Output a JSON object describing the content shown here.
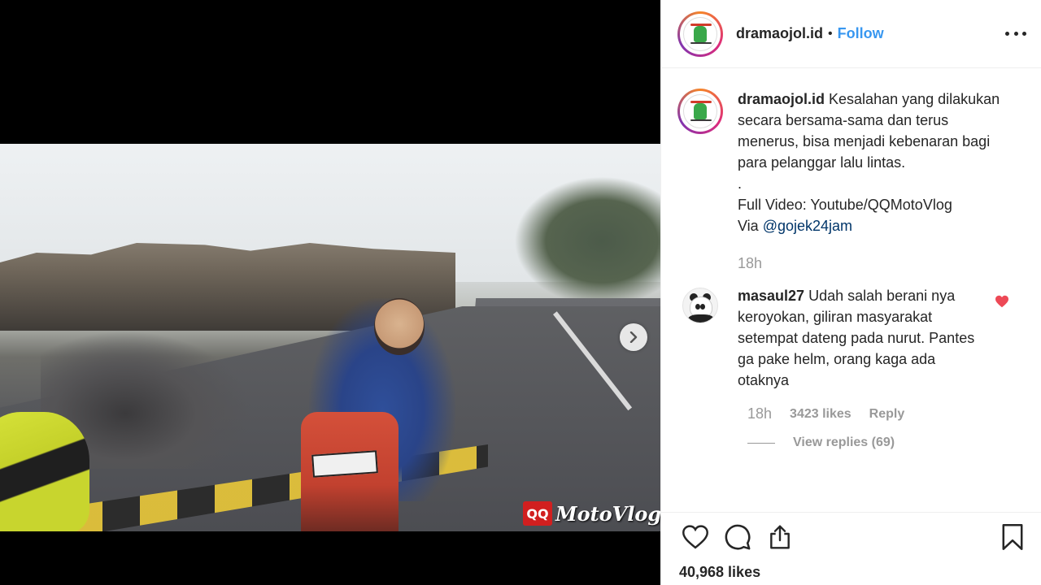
{
  "header": {
    "username": "dramaojol.id",
    "separator": "•",
    "follow_label": "Follow",
    "more_icon": "more-horizontal-icon"
  },
  "caption": {
    "username": "dramaojol.id",
    "text": "Kesalahan yang dilakukan secara bersama-sama dan terus menerus, bisa menjadi kebenaran bagi para pelanggar lalu lintas.",
    "dot": ".",
    "full_video": "Full Video: Youtube/QQMotoVlog",
    "via_prefix": "Via ",
    "mention": "@gojek24jam",
    "time": "18h"
  },
  "comment": {
    "username": "masaul27",
    "text": "Udah salah berani nya keroyokan, giliran masyarakat setempat dateng pada nurut. Pantes ga pake helm, orang kaga ada otaknya",
    "time": "18h",
    "likes": "3423 likes",
    "reply_label": "Reply",
    "view_replies": "View replies (69)",
    "liked": true
  },
  "media": {
    "watermark_badge": "QQ",
    "watermark_text": "MotoVlog"
  },
  "actions": {
    "like_icon": "heart-icon",
    "comment_icon": "comment-icon",
    "share_icon": "share-icon",
    "save_icon": "bookmark-icon"
  },
  "likes_count": "40,968 likes",
  "colors": {
    "follow": "#3897f0",
    "text": "#262626",
    "muted": "#999999",
    "heart": "#ed4956",
    "mention": "#003569"
  }
}
